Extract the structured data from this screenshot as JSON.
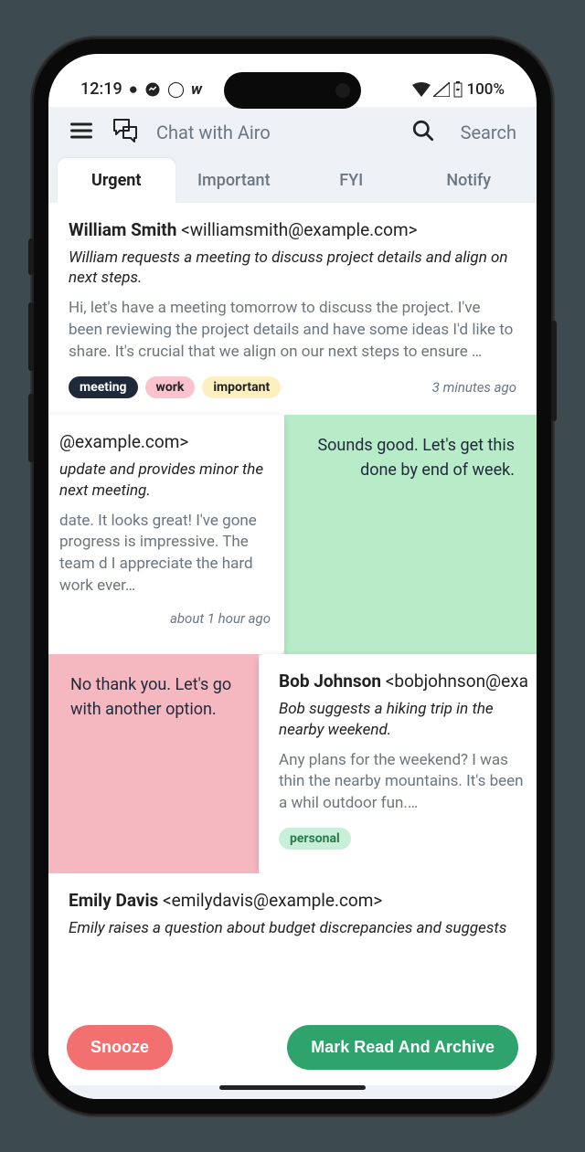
{
  "status": {
    "time": "12:19",
    "battery": "100%"
  },
  "topbar": {
    "chat_label": "Chat with Airo",
    "search_label": "Search"
  },
  "tabs": [
    {
      "label": "Urgent",
      "active": true
    },
    {
      "label": "Important",
      "active": false
    },
    {
      "label": "FYI",
      "active": false
    },
    {
      "label": "Notify",
      "active": false
    }
  ],
  "emails": [
    {
      "name": "William Smith",
      "email": "<williamsmith@example.com>",
      "summary": "William requests a meeting to discuss project details and align on next steps.",
      "preview": "Hi, let's have a meeting tomorrow to discuss the project. I've been reviewing the project details and have some ideas I'd like to share. It's crucial that we align on our next steps to ensure …",
      "tags": [
        "meeting",
        "work",
        "important"
      ],
      "timestamp": "3 minutes ago"
    },
    {
      "name": "",
      "email": "@example.com>",
      "summary": "update and provides minor the next meeting.",
      "preview": "date. It looks great! I've gone progress is impressive. The team d I appreciate the hard work ever…",
      "tags": [],
      "timestamp": "about 1 hour ago",
      "swipe_right_text": "Sounds good. Let's get this done by end of week."
    },
    {
      "name": "Bob Johnson",
      "email": "<bobjohnson@exa",
      "summary": "Bob suggests a hiking trip in the nearby weekend.",
      "preview": "Any plans for the weekend? I was thin the nearby mountains. It's been a whil outdoor fun.…",
      "tags": [
        "personal"
      ],
      "timestamp": "",
      "swipe_left_text": "No thank you. Let's go with another option."
    },
    {
      "name": "Emily Davis",
      "email": "<emilydavis@example.com>",
      "summary": "Emily raises a question about budget discrepancies and suggests",
      "preview": "",
      "tags": [],
      "timestamp": ""
    }
  ],
  "actions": {
    "snooze": "Snooze",
    "archive": "Mark Read And Archive"
  }
}
